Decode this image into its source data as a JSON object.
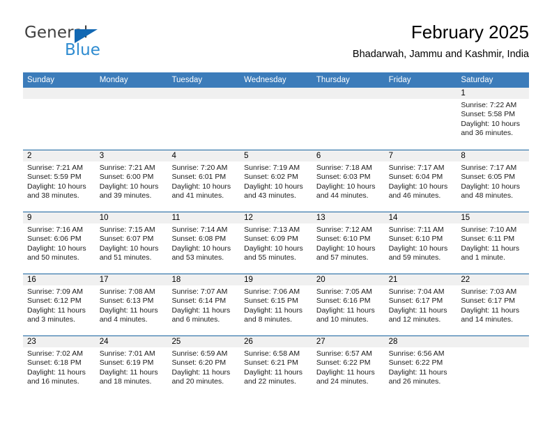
{
  "brand": {
    "name_top": "General",
    "name_bottom": "Blue",
    "accent_color": "#1268b3",
    "blue_text_color": "#2e8bd0"
  },
  "header": {
    "title": "February 2025",
    "subtitle": "Bhadarwah, Jammu and Kashmir, India"
  },
  "calendar": {
    "header_bg": "#3c7cba",
    "row_divider_color": "#15619e",
    "day_band_bg": "#f0f0f0",
    "weekdays": [
      "Sunday",
      "Monday",
      "Tuesday",
      "Wednesday",
      "Thursday",
      "Friday",
      "Saturday"
    ],
    "weeks": [
      [
        {
          "day": "",
          "empty": true
        },
        {
          "day": "",
          "empty": true
        },
        {
          "day": "",
          "empty": true
        },
        {
          "day": "",
          "empty": true
        },
        {
          "day": "",
          "empty": true
        },
        {
          "day": "",
          "empty": true
        },
        {
          "day": "1",
          "sunrise": "Sunrise: 7:22 AM",
          "sunset": "Sunset: 5:58 PM",
          "daylight": "Daylight: 10 hours and 36 minutes."
        }
      ],
      [
        {
          "day": "2",
          "sunrise": "Sunrise: 7:21 AM",
          "sunset": "Sunset: 5:59 PM",
          "daylight": "Daylight: 10 hours and 38 minutes."
        },
        {
          "day": "3",
          "sunrise": "Sunrise: 7:21 AM",
          "sunset": "Sunset: 6:00 PM",
          "daylight": "Daylight: 10 hours and 39 minutes."
        },
        {
          "day": "4",
          "sunrise": "Sunrise: 7:20 AM",
          "sunset": "Sunset: 6:01 PM",
          "daylight": "Daylight: 10 hours and 41 minutes."
        },
        {
          "day": "5",
          "sunrise": "Sunrise: 7:19 AM",
          "sunset": "Sunset: 6:02 PM",
          "daylight": "Daylight: 10 hours and 43 minutes."
        },
        {
          "day": "6",
          "sunrise": "Sunrise: 7:18 AM",
          "sunset": "Sunset: 6:03 PM",
          "daylight": "Daylight: 10 hours and 44 minutes."
        },
        {
          "day": "7",
          "sunrise": "Sunrise: 7:17 AM",
          "sunset": "Sunset: 6:04 PM",
          "daylight": "Daylight: 10 hours and 46 minutes."
        },
        {
          "day": "8",
          "sunrise": "Sunrise: 7:17 AM",
          "sunset": "Sunset: 6:05 PM",
          "daylight": "Daylight: 10 hours and 48 minutes."
        }
      ],
      [
        {
          "day": "9",
          "sunrise": "Sunrise: 7:16 AM",
          "sunset": "Sunset: 6:06 PM",
          "daylight": "Daylight: 10 hours and 50 minutes."
        },
        {
          "day": "10",
          "sunrise": "Sunrise: 7:15 AM",
          "sunset": "Sunset: 6:07 PM",
          "daylight": "Daylight: 10 hours and 51 minutes."
        },
        {
          "day": "11",
          "sunrise": "Sunrise: 7:14 AM",
          "sunset": "Sunset: 6:08 PM",
          "daylight": "Daylight: 10 hours and 53 minutes."
        },
        {
          "day": "12",
          "sunrise": "Sunrise: 7:13 AM",
          "sunset": "Sunset: 6:09 PM",
          "daylight": "Daylight: 10 hours and 55 minutes."
        },
        {
          "day": "13",
          "sunrise": "Sunrise: 7:12 AM",
          "sunset": "Sunset: 6:10 PM",
          "daylight": "Daylight: 10 hours and 57 minutes."
        },
        {
          "day": "14",
          "sunrise": "Sunrise: 7:11 AM",
          "sunset": "Sunset: 6:10 PM",
          "daylight": "Daylight: 10 hours and 59 minutes."
        },
        {
          "day": "15",
          "sunrise": "Sunrise: 7:10 AM",
          "sunset": "Sunset: 6:11 PM",
          "daylight": "Daylight: 11 hours and 1 minute."
        }
      ],
      [
        {
          "day": "16",
          "sunrise": "Sunrise: 7:09 AM",
          "sunset": "Sunset: 6:12 PM",
          "daylight": "Daylight: 11 hours and 3 minutes."
        },
        {
          "day": "17",
          "sunrise": "Sunrise: 7:08 AM",
          "sunset": "Sunset: 6:13 PM",
          "daylight": "Daylight: 11 hours and 4 minutes."
        },
        {
          "day": "18",
          "sunrise": "Sunrise: 7:07 AM",
          "sunset": "Sunset: 6:14 PM",
          "daylight": "Daylight: 11 hours and 6 minutes."
        },
        {
          "day": "19",
          "sunrise": "Sunrise: 7:06 AM",
          "sunset": "Sunset: 6:15 PM",
          "daylight": "Daylight: 11 hours and 8 minutes."
        },
        {
          "day": "20",
          "sunrise": "Sunrise: 7:05 AM",
          "sunset": "Sunset: 6:16 PM",
          "daylight": "Daylight: 11 hours and 10 minutes."
        },
        {
          "day": "21",
          "sunrise": "Sunrise: 7:04 AM",
          "sunset": "Sunset: 6:17 PM",
          "daylight": "Daylight: 11 hours and 12 minutes."
        },
        {
          "day": "22",
          "sunrise": "Sunrise: 7:03 AM",
          "sunset": "Sunset: 6:17 PM",
          "daylight": "Daylight: 11 hours and 14 minutes."
        }
      ],
      [
        {
          "day": "23",
          "sunrise": "Sunrise: 7:02 AM",
          "sunset": "Sunset: 6:18 PM",
          "daylight": "Daylight: 11 hours and 16 minutes."
        },
        {
          "day": "24",
          "sunrise": "Sunrise: 7:01 AM",
          "sunset": "Sunset: 6:19 PM",
          "daylight": "Daylight: 11 hours and 18 minutes."
        },
        {
          "day": "25",
          "sunrise": "Sunrise: 6:59 AM",
          "sunset": "Sunset: 6:20 PM",
          "daylight": "Daylight: 11 hours and 20 minutes."
        },
        {
          "day": "26",
          "sunrise": "Sunrise: 6:58 AM",
          "sunset": "Sunset: 6:21 PM",
          "daylight": "Daylight: 11 hours and 22 minutes."
        },
        {
          "day": "27",
          "sunrise": "Sunrise: 6:57 AM",
          "sunset": "Sunset: 6:22 PM",
          "daylight": "Daylight: 11 hours and 24 minutes."
        },
        {
          "day": "28",
          "sunrise": "Sunrise: 6:56 AM",
          "sunset": "Sunset: 6:22 PM",
          "daylight": "Daylight: 11 hours and 26 minutes."
        },
        {
          "day": "",
          "empty": true
        }
      ]
    ]
  }
}
